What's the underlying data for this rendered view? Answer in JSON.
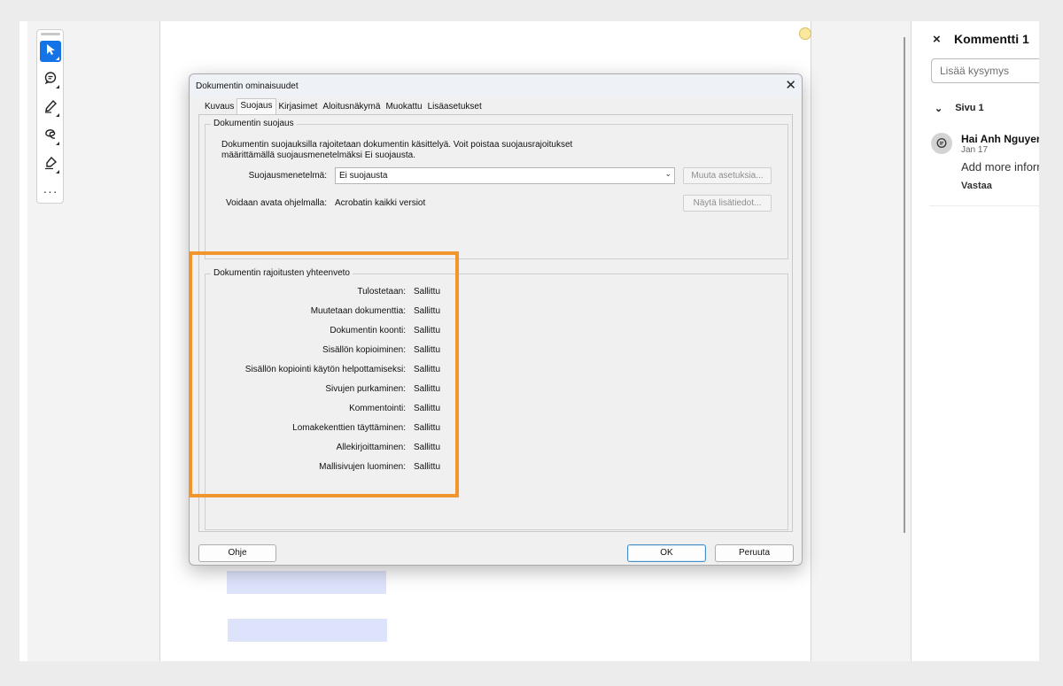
{
  "toolbar": {
    "tools": [
      {
        "name": "select-tool",
        "icon": "cursor-icon",
        "active": true
      },
      {
        "name": "comment-tool",
        "icon": "comment-icon",
        "active": false
      },
      {
        "name": "pen-tool",
        "icon": "pen-icon",
        "active": false
      },
      {
        "name": "lasso-tool",
        "icon": "lasso-icon",
        "active": false
      },
      {
        "name": "sign-tool",
        "icon": "sign-icon",
        "active": false
      }
    ],
    "more_label": "···"
  },
  "panel": {
    "close_label": "×",
    "title": "Kommentti 1",
    "question_placeholder": "Lisää kysymys",
    "page_group": "Sivu 1",
    "chevron": "⌄",
    "comment": {
      "author": "Hai Anh Nguyen",
      "date": "Jan 17",
      "text": "Add more inform",
      "reply_label": "Vastaa"
    }
  },
  "dialog": {
    "title": "Dokumentin ominaisuudet",
    "close_label": "✕",
    "tabs": [
      "Kuvaus",
      "Suojaus",
      "Kirjasimet",
      "Aloitusnäkymä",
      "Muokattu",
      "Lisäasetukset"
    ],
    "selected_tab": "Suojaus",
    "security": {
      "legend": "Dokumentin suojaus",
      "description": "Dokumentin suojauksilla rajoitetaan dokumentin käsittelyä. Voit poistaa suojausrajoitukset määrittämällä suojausmenetelmäksi Ei suojausta.",
      "method_label": "Suojausmenetelmä:",
      "method_value": "Ei suojausta",
      "change_settings_button": "Muuta asetuksia...",
      "open_with_label": "Voidaan avata ohjelmalla:",
      "open_with_value": "Acrobatin kaikki versiot",
      "show_details_button": "Näytä lisätiedot..."
    },
    "restrictions": {
      "legend": "Dokumentin rajoitusten yhteenveto",
      "rows": [
        {
          "label": "Tulostetaan:",
          "value": "Sallittu"
        },
        {
          "label": "Muutetaan dokumenttia:",
          "value": "Sallittu"
        },
        {
          "label": "Dokumentin koonti:",
          "value": "Sallittu"
        },
        {
          "label": "Sisällön kopioiminen:",
          "value": "Sallittu"
        },
        {
          "label": "Sisällön kopiointi käytön helpottamiseksi:",
          "value": "Sallittu"
        },
        {
          "label": "Sivujen purkaminen:",
          "value": "Sallittu"
        },
        {
          "label": "Kommentointi:",
          "value": "Sallittu"
        },
        {
          "label": "Lomakekenttien täyttäminen:",
          "value": "Sallittu"
        },
        {
          "label": "Allekirjoittaminen:",
          "value": "Sallittu"
        },
        {
          "label": "Mallisivujen luominen:",
          "value": "Sallittu"
        }
      ]
    },
    "buttons": {
      "help": "Ohje",
      "ok": "OK",
      "cancel": "Peruuta"
    }
  },
  "colors": {
    "accent": "#1473e6",
    "highlight_border": "#f0962c",
    "text_highlight": "#dde3fb"
  }
}
